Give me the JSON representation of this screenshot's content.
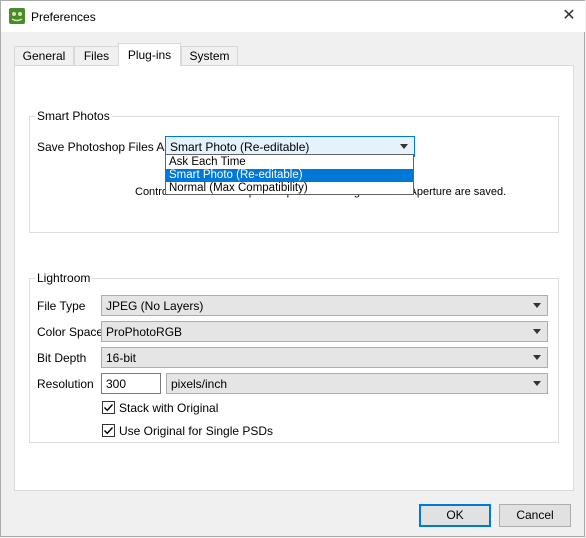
{
  "window": {
    "title": "Preferences",
    "close_glyph": "✕",
    "icon": "lightroom-plugin-icon"
  },
  "tabs": [
    {
      "label": "General",
      "active": false
    },
    {
      "label": "Files",
      "active": false
    },
    {
      "label": "Plug-ins",
      "active": true
    },
    {
      "label": "System",
      "active": false
    }
  ],
  "smart_photos": {
    "group_label": "Smart Photos",
    "save_label": "Save Photoshop Files As:",
    "selected": "Smart Photo (Re-editable)",
    "options": [
      "Ask Each Time",
      "Smart Photo (Re-editable)",
      "Normal (Max Compatibility)"
    ],
    "hint": "Controls how Photoshop files opened from Lightroom or Aperture are saved."
  },
  "lightroom": {
    "group_label": "Lightroom",
    "file_type_label": "File Type",
    "file_type_value": "JPEG (No Layers)",
    "color_space_label": "Color Space",
    "color_space_value": "ProPhotoRGB",
    "bit_depth_label": "Bit Depth",
    "bit_depth_value": "16-bit",
    "resolution_label": "Resolution",
    "resolution_value": "300",
    "resolution_unit": "pixels/inch",
    "stack_label": "Stack with Original",
    "stack_checked": true,
    "use_original_label": "Use Original for Single PSDs",
    "use_original_checked": true
  },
  "buttons": {
    "ok": "OK",
    "cancel": "Cancel"
  },
  "colors": {
    "accent": "#0078d7"
  }
}
